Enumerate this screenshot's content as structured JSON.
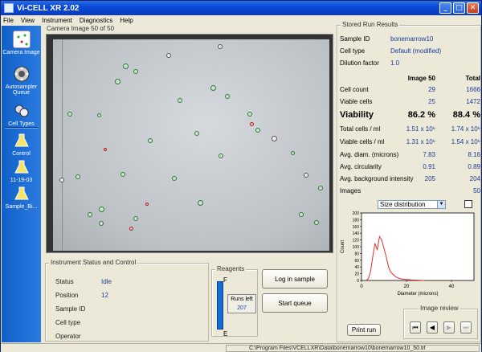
{
  "window": {
    "title": "Vi-CELL XR 2.02"
  },
  "menu": [
    "File",
    "View",
    "Instrument",
    "Diagnostics",
    "Help"
  ],
  "sidebar": {
    "items": [
      {
        "label": "Camera Image",
        "icon": "camera-icon"
      },
      {
        "label": "Autosampler Queue",
        "icon": "queue-icon"
      },
      {
        "label": "Cell Types",
        "icon": "cells-icon"
      },
      {
        "label": "Control",
        "icon": "flask-icon"
      },
      {
        "label": "11-19-03",
        "icon": "flask-icon"
      },
      {
        "label": "Sample_Bi...",
        "icon": "flask-icon"
      }
    ]
  },
  "camera": {
    "label": "Camera Image 50 of 50"
  },
  "instrument": {
    "title": "Instrument Status and Control",
    "rows": [
      {
        "key": "Status",
        "value": "Idle"
      },
      {
        "key": "Position",
        "value": "12"
      },
      {
        "key": "Sample ID",
        "value": ""
      },
      {
        "key": "Cell type",
        "value": ""
      },
      {
        "key": "Operator",
        "value": ""
      }
    ]
  },
  "reagents": {
    "title": "Reagents",
    "full_label": "F",
    "empty_label": "E",
    "runs_left_label": "Runs left",
    "runs_left": "207",
    "level": 0.95
  },
  "buttons": {
    "log_in_sample": "Log in sample",
    "start_queue": "Start queue",
    "print_run": "Print run"
  },
  "results": {
    "title": "Stored Run Results",
    "sample_id_label": "Sample ID",
    "sample_id": "bonemarrow10",
    "cell_type_label": "Cell type",
    "cell_type": "Default (modified)",
    "dilution_label": "Dilution factor",
    "dilution": "1.0",
    "col_image": "Image 50",
    "col_total": "Total",
    "rows": [
      {
        "key": "Cell count",
        "image": "29",
        "total": "1666"
      },
      {
        "key": "Viable cells",
        "image": "25",
        "total": "1472"
      },
      {
        "key": "Viability",
        "image": "86.2 %",
        "total": "88.4 %"
      },
      {
        "key": "Total cells / ml",
        "image": "1.51 x 10⁶",
        "total": "1.74 x 10⁶"
      },
      {
        "key": "Viable cells / ml",
        "image": "1.31 x 10⁶",
        "total": "1.54 x 10⁶"
      },
      {
        "key": "Avg. diam. (microns)",
        "image": "7.83",
        "total": "8.16"
      },
      {
        "key": "Avg. circularity",
        "image": "0.91",
        "total": "0.89"
      },
      {
        "key": "Avg. background intensity",
        "image": "205",
        "total": "204"
      },
      {
        "key": "Images",
        "image": "",
        "total": "50"
      }
    ],
    "dropdown": "Size distribution"
  },
  "chart_data": {
    "type": "line",
    "xlabel": "Diameter (microns)",
    "ylabel": "Count",
    "xlim": [
      0,
      50
    ],
    "ylim": [
      0,
      200
    ],
    "xticks": [
      0,
      20,
      40
    ],
    "yticks": [
      0,
      20,
      40,
      60,
      80,
      100,
      120,
      140,
      160,
      180,
      200
    ],
    "series": [
      {
        "color": "#e03030",
        "x": [
          2,
          3,
          4,
          5,
          6,
          7,
          8,
          9,
          10,
          11,
          12,
          13,
          14,
          15,
          16,
          17,
          18,
          20,
          22,
          25,
          28
        ],
        "y": [
          0,
          5,
          25,
          70,
          110,
          90,
          130,
          120,
          95,
          70,
          40,
          25,
          18,
          12,
          8,
          6,
          4,
          3,
          2,
          1,
          0
        ]
      }
    ]
  },
  "image_review": {
    "title": "Image review"
  },
  "statusbar": {
    "path": "C:\\Program Files\\VCELLXR\\Data\\bonemarrow10\\bonemarrow10_50.tif"
  }
}
